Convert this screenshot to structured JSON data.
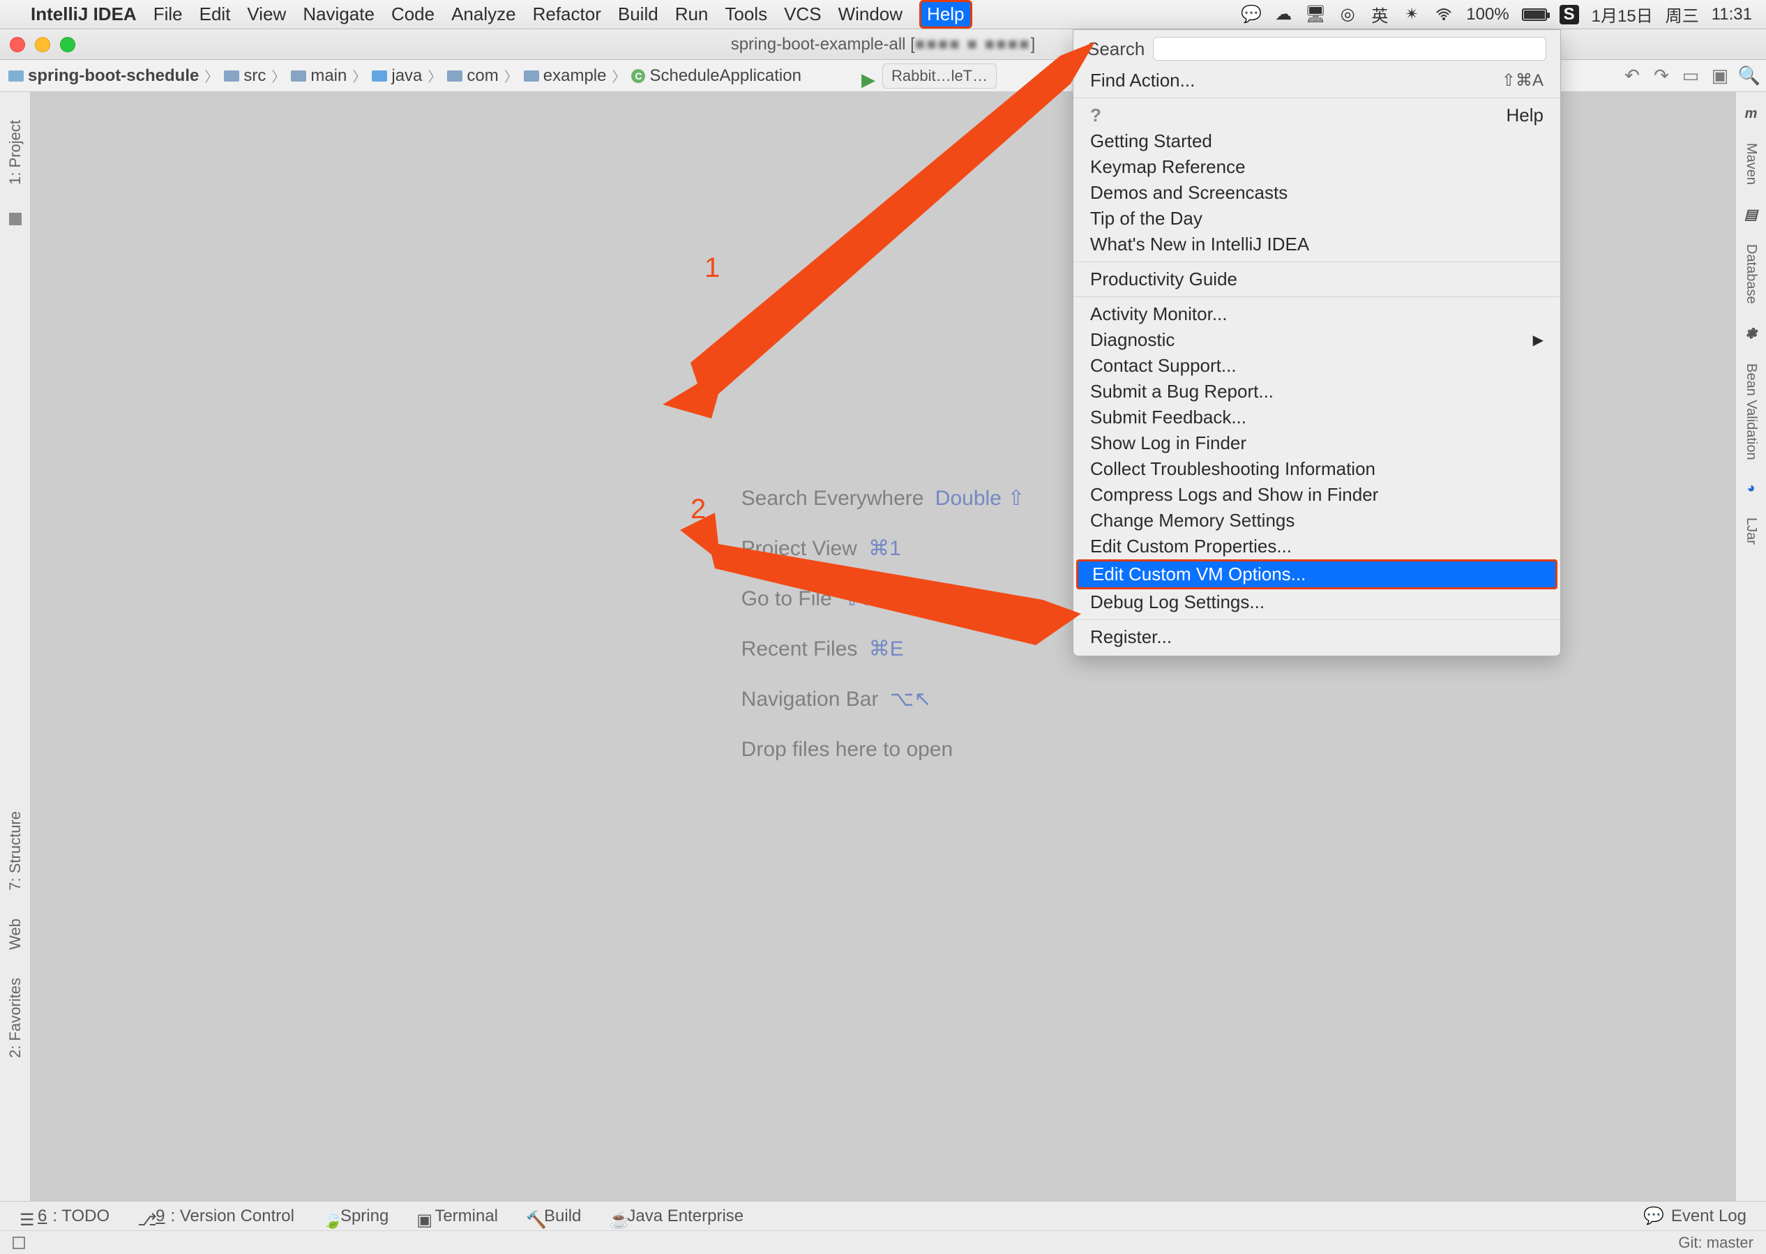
{
  "mac": {
    "app": "IntelliJ IDEA",
    "menus": [
      "File",
      "Edit",
      "View",
      "Navigate",
      "Code",
      "Analyze",
      "Refactor",
      "Build",
      "Run",
      "Tools",
      "VCS",
      "Window"
    ],
    "help": "Help",
    "battery": "100%",
    "date": "1月15日",
    "weekday": "周三",
    "time": "11:31"
  },
  "window": {
    "title_prefix": "spring-boot-example-all [",
    "title_blur": "■■■■  ■  ■■■■",
    "title_suffix": "]"
  },
  "breadcrumbs": [
    {
      "label": "spring-boot-schedule",
      "type": "mod",
      "bold": true
    },
    {
      "label": "src",
      "type": "folder"
    },
    {
      "label": "main",
      "type": "folder"
    },
    {
      "label": "java",
      "type": "blue"
    },
    {
      "label": "com",
      "type": "folder"
    },
    {
      "label": "example",
      "type": "folder"
    },
    {
      "label": "ScheduleApplication",
      "type": "class"
    }
  ],
  "tab": "Rabbit…leT…",
  "left_stripe": [
    "1: Project",
    "7: Structure",
    "Web",
    "2: Favorites"
  ],
  "right_stripe": [
    "Maven",
    "Database",
    "Bean Validation",
    "LJar"
  ],
  "welcome": [
    {
      "label": "Search Everywhere",
      "shortcut": "Double ⇧"
    },
    {
      "label": "Project View",
      "shortcut": "⌘1"
    },
    {
      "label": "Go to File",
      "shortcut": "⇧⌘N"
    },
    {
      "label": "Recent Files",
      "shortcut": "⌘E"
    },
    {
      "label": "Navigation Bar",
      "shortcut": "⌥↖"
    },
    {
      "label": "Drop files here to open",
      "shortcut": ""
    }
  ],
  "popup": {
    "search_label": "Search",
    "groups": [
      [
        {
          "label": "Find Action...",
          "shortcut": "⇧⌘A"
        }
      ],
      [
        {
          "label": "Help",
          "helpq": true
        },
        {
          "label": "Getting Started"
        },
        {
          "label": "Keymap Reference"
        },
        {
          "label": "Demos and Screencasts"
        },
        {
          "label": "Tip of the Day"
        },
        {
          "label": "What's New in IntelliJ IDEA"
        }
      ],
      [
        {
          "label": "Productivity Guide"
        }
      ],
      [
        {
          "label": "Activity Monitor..."
        },
        {
          "label": "Diagnostic",
          "submenu": true
        },
        {
          "label": "Contact Support..."
        },
        {
          "label": "Submit a Bug Report..."
        },
        {
          "label": "Submit Feedback..."
        },
        {
          "label": "Show Log in Finder"
        },
        {
          "label": "Collect Troubleshooting Information"
        },
        {
          "label": "Compress Logs and Show in Finder"
        },
        {
          "label": "Change Memory Settings"
        },
        {
          "label": "Edit Custom Properties..."
        },
        {
          "label": "Edit Custom VM Options...",
          "highlight": true
        },
        {
          "label": "Debug Log Settings..."
        }
      ],
      [
        {
          "label": "Register..."
        }
      ]
    ]
  },
  "annotations": {
    "num1": "1",
    "num2": "2"
  },
  "bottom": {
    "tools": [
      {
        "u": "6",
        "rest": ": TODO"
      },
      {
        "u": "9",
        "rest": ": Version Control"
      },
      {
        "u": "",
        "rest": "Spring"
      },
      {
        "u": "",
        "rest": "Terminal"
      },
      {
        "u": "",
        "rest": "Build"
      },
      {
        "u": "",
        "rest": "Java Enterprise"
      }
    ],
    "event_log": "Event Log",
    "git": "Git: master"
  }
}
